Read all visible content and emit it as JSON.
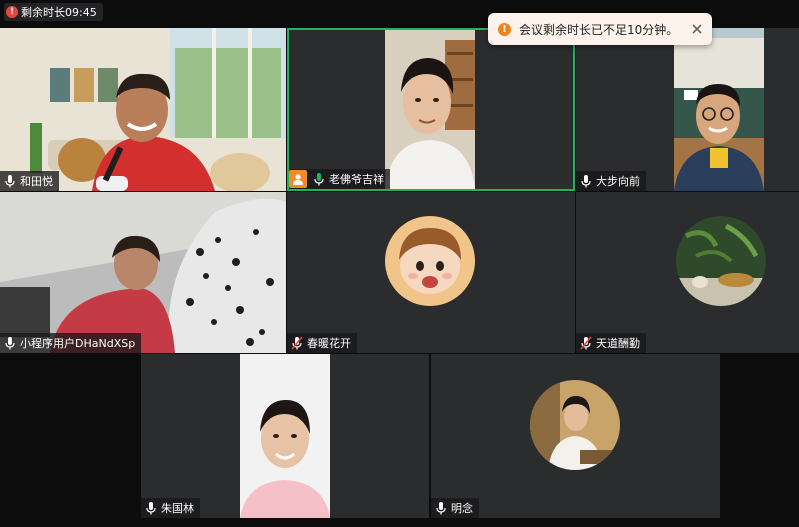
{
  "timer": {
    "label": "剩余时长09:45",
    "icon": "alert-icon"
  },
  "toast": {
    "message": "会议剩余时长已不足10分钟。",
    "icon": "warning-icon",
    "close_icon": "close-icon"
  },
  "colors": {
    "active_border": "#21b35c",
    "host_badge": "#f08b2a",
    "toast_bg": "#fdf3ec",
    "warning": "#f0831e",
    "tile_bg": "#2b2c2e"
  },
  "participants": [
    {
      "name": "和田悦",
      "mic": "on"
    },
    {
      "name": "老佛爷吉祥",
      "mic": "on",
      "host": true,
      "speaking": true
    },
    {
      "name": "大步向前",
      "mic": "on"
    },
    {
      "name": "小程序用户DHaNdXSp",
      "mic": "on"
    },
    {
      "name": "春暖花开",
      "mic": "muted"
    },
    {
      "name": "天道酬勤",
      "mic": "muted"
    },
    {
      "name": "朱国林",
      "mic": "on"
    },
    {
      "name": "明念",
      "mic": "on"
    }
  ]
}
